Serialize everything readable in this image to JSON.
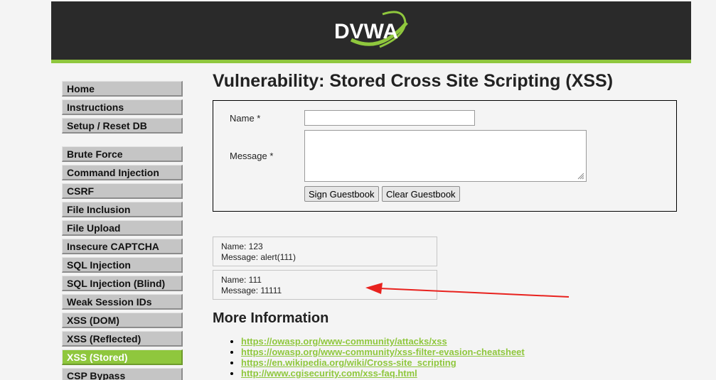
{
  "header": {
    "logo_text": "DVWA"
  },
  "menu": {
    "blocks": [
      {
        "items": [
          "Home",
          "Instructions",
          "Setup / Reset DB"
        ]
      },
      {
        "items": [
          "Brute Force",
          "Command Injection",
          "CSRF",
          "File Inclusion",
          "File Upload",
          "Insecure CAPTCHA",
          "SQL Injection",
          "SQL Injection (Blind)",
          "Weak Session IDs",
          "XSS (DOM)",
          "XSS (Reflected)",
          "XSS (Stored)",
          "CSP Bypass"
        ]
      }
    ],
    "selected": "XSS (Stored)"
  },
  "main": {
    "title": "Vulnerability: Stored Cross Site Scripting (XSS)",
    "form": {
      "name_label": "Name *",
      "message_label": "Message *",
      "name_value": "",
      "message_value": "",
      "sign_button": "Sign Guestbook",
      "clear_button": "Clear Guestbook"
    },
    "entries": [
      {
        "name": "Name: 123",
        "message": "Message: alert(111)"
      },
      {
        "name": "Name: 111",
        "message": "Message: 11111"
      }
    ],
    "more_info_title": "More Information",
    "links": [
      "https://owasp.org/www-community/attacks/xss",
      "https://owasp.org/www-community/xss-filter-evasion-cheatsheet",
      "https://en.wikipedia.org/wiki/Cross-site_scripting",
      "http://www.cgisecurity.com/xss-faq.html"
    ]
  },
  "colors": {
    "accent": "#8fc73d",
    "header_bg": "#2a2a2a",
    "arrow": "#e8221e"
  }
}
